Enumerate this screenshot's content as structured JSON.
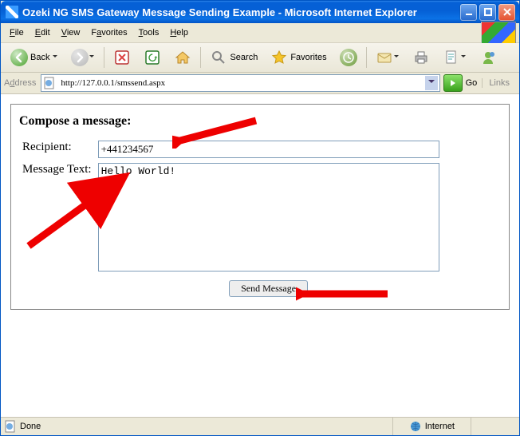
{
  "window": {
    "title": "Ozeki NG SMS Gateway Message Sending Example - Microsoft Internet Explorer"
  },
  "menu": {
    "file": "File",
    "edit": "Edit",
    "view": "View",
    "favorites": "Favorites",
    "tools": "Tools",
    "help": "Help"
  },
  "toolbar": {
    "back": "Back",
    "search": "Search",
    "favorites": "Favorites"
  },
  "address": {
    "label": "Address",
    "url": "http://127.0.0.1/smssend.aspx",
    "go": "Go",
    "links": "Links"
  },
  "form": {
    "heading": "Compose a message:",
    "recipient_label": "Recipient:",
    "recipient_value": "+441234567",
    "message_label": "Message Text:",
    "message_value": "Hello World!",
    "send_label": "Send Message"
  },
  "status": {
    "done": "Done",
    "zone": "Internet"
  }
}
